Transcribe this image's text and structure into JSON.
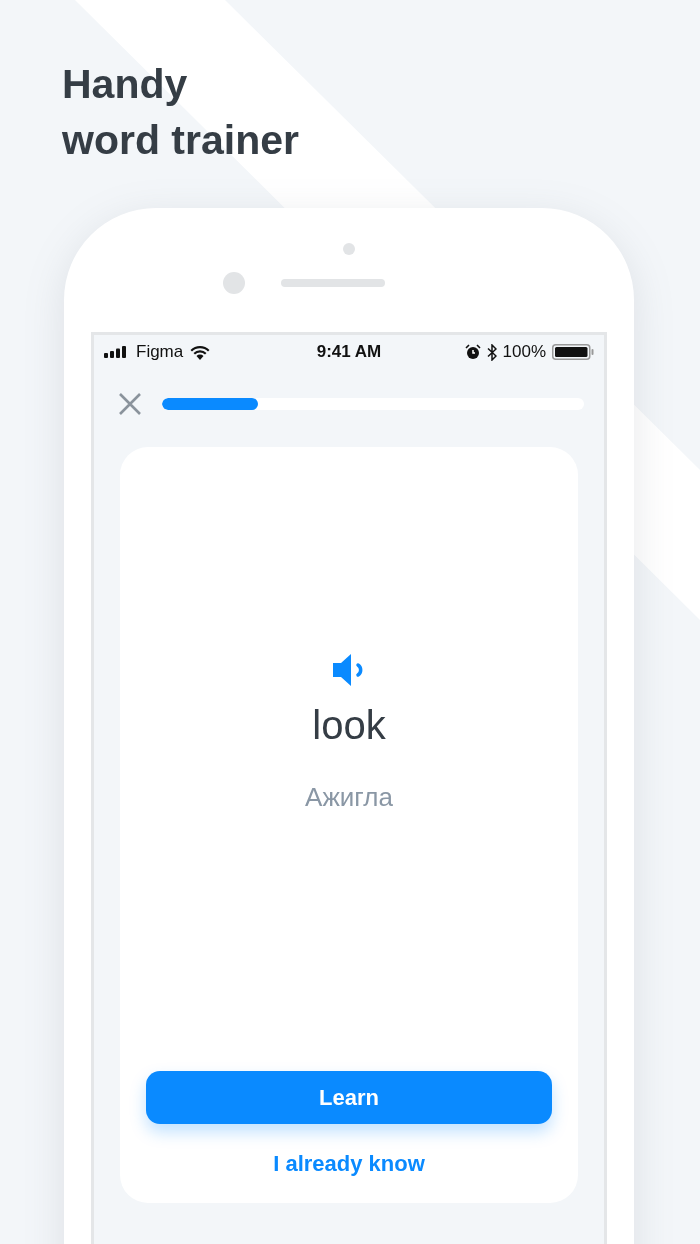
{
  "headline": [
    "Handy",
    "word trainer"
  ],
  "status_bar": {
    "carrier": "Figma",
    "time": "9:41 AM",
    "battery": "100%"
  },
  "progress": {
    "level": 0.227
  },
  "card": {
    "word": "look",
    "translation": "Ажигла"
  },
  "buttons": {
    "primary": "Learn",
    "secondary": "I already know"
  }
}
